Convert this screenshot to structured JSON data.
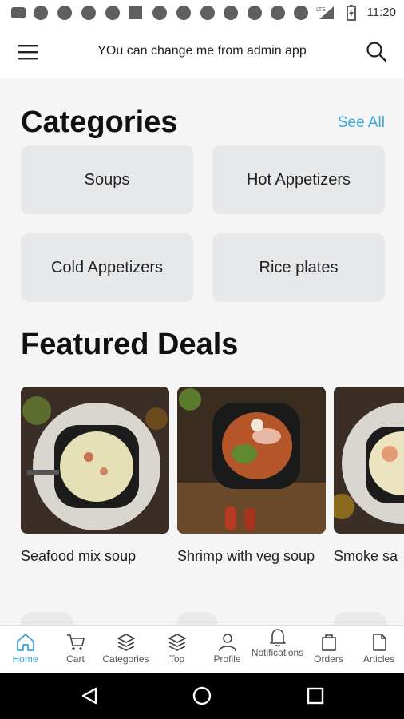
{
  "status_bar": {
    "time": "11:20",
    "notification_icons": [
      "app-icon",
      "app-icon",
      "app-icon",
      "app-icon",
      "stop-icon",
      "app-icon",
      "app-icon",
      "app-icon",
      "app-icon",
      "app-icon",
      "app-icon",
      "app-icon"
    ],
    "network_label": "LTE"
  },
  "app_bar": {
    "title": "YOu can change me from admin app",
    "menu_icon": "hamburger-menu-icon",
    "search_icon": "search-icon"
  },
  "categories": {
    "title": "Categories",
    "see_all": "See All",
    "items": [
      {
        "label": "Soups"
      },
      {
        "label": "Hot Appetizers"
      },
      {
        "label": "Cold Appetizers"
      },
      {
        "label": "Rice plates"
      }
    ]
  },
  "featured": {
    "title": "Featured Deals",
    "items": [
      {
        "name": "Seafood mix soup"
      },
      {
        "name": "Shrimp with veg soup"
      },
      {
        "name": "Smoke sa"
      }
    ]
  },
  "bottom_nav": {
    "active_color": "#3aa6e0",
    "items": [
      {
        "label": "Home",
        "icon": "home-icon"
      },
      {
        "label": "Cart",
        "icon": "cart-icon"
      },
      {
        "label": "Categories",
        "icon": "layers-icon"
      },
      {
        "label": "Top",
        "icon": "stack-icon"
      },
      {
        "label": "Profile",
        "icon": "person-icon"
      },
      {
        "label": "Notifications",
        "icon": "bell-icon"
      },
      {
        "label": "Orders",
        "icon": "bag-icon"
      },
      {
        "label": "Articles",
        "icon": "document-icon"
      }
    ]
  },
  "system_nav": {
    "icons": [
      "back-icon",
      "home-circle-icon",
      "recents-icon"
    ]
  }
}
